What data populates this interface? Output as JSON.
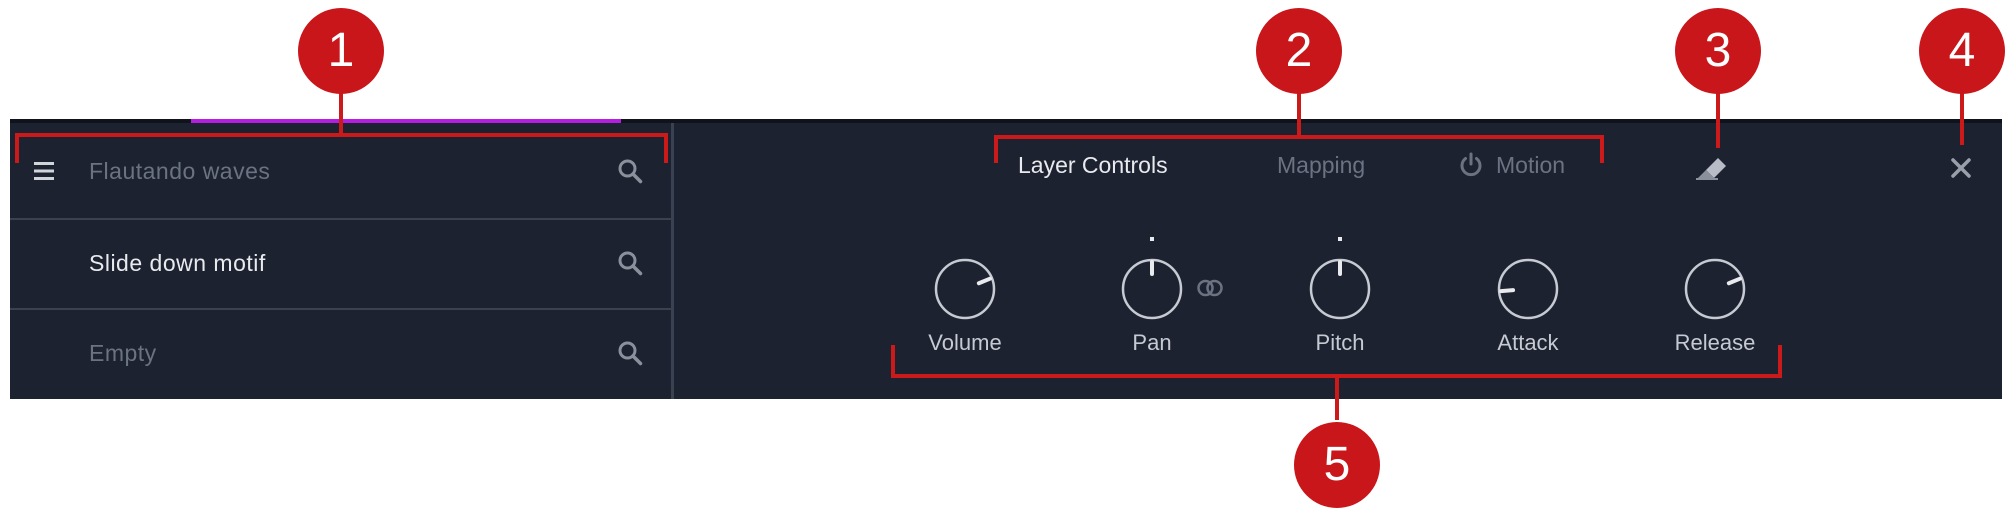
{
  "layers": [
    {
      "name": "Flautando waves"
    },
    {
      "name": "Slide down motif"
    },
    {
      "name": "Empty"
    }
  ],
  "tabs": [
    {
      "label": "Layer Controls",
      "state": "active"
    },
    {
      "label": "Mapping",
      "state": "inactive"
    },
    {
      "label": "Motion",
      "state": "inactive"
    }
  ],
  "knobs": [
    {
      "label": "Volume",
      "value": 0.75
    },
    {
      "label": "Pan",
      "value": 0.5
    },
    {
      "label": "Pitch",
      "value": 0.5
    },
    {
      "label": "Attack",
      "value": 0.15
    },
    {
      "label": "Release",
      "value": 0.75
    }
  ],
  "icons": {
    "menu": "hamburger-icon",
    "search": "search-icon",
    "power": "power-icon",
    "eraser": "eraser-icon",
    "close": "close-icon",
    "link": "link-icon"
  },
  "callouts": [
    "1",
    "2",
    "3",
    "4",
    "5"
  ],
  "colors": {
    "panel": "#1d2230",
    "accent": "#b51ee0",
    "callout": "#c8161b",
    "text_active": "#e8eaee",
    "text_inactive": "#6b7382"
  }
}
